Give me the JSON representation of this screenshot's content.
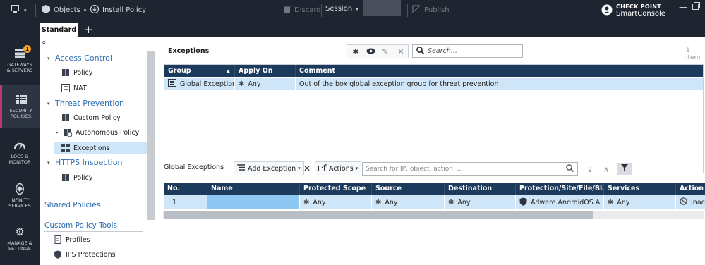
{
  "topbar": {
    "objects_label": "Objects",
    "install_policy_label": "Install Policy",
    "discard_label": "Discard",
    "session_label": "Session",
    "publish_label": "Publish",
    "brand_line1": "CHECK POINT",
    "brand_line2": "SmartConsole"
  },
  "tabs": {
    "active": "Standard",
    "add": "+"
  },
  "leftnav": {
    "badge": "1",
    "items": [
      {
        "label1": "GATEWAYS",
        "label2": "& SERVERS"
      },
      {
        "label1": "SECURITY",
        "label2": "POLICIES"
      },
      {
        "label1": "LOGS &",
        "label2": "MONITOR"
      },
      {
        "label1": "INFINITY",
        "label2": "SERVICES"
      },
      {
        "label1": "MANAGE &",
        "label2": "SETTINGS"
      }
    ]
  },
  "tree": {
    "collapse": "«",
    "access_control": "Access Control",
    "policy": "Policy",
    "nat": "NAT",
    "threat_prevention": "Threat Prevention",
    "custom_policy": "Custom Policy",
    "autonomous_policy": "Autonomous Policy",
    "exceptions": "Exceptions",
    "https_inspection": "HTTPS Inspection",
    "https_policy": "Policy",
    "shared_policies": "Shared Policies",
    "custom_policy_tools": "Custom Policy Tools",
    "profiles": "Profiles",
    "ips_protections": "IPS Protections"
  },
  "exceptions": {
    "title": "Exceptions",
    "search_placeholder": "Search...",
    "count": "1 item",
    "columns": [
      "Group",
      "Apply On",
      "Comment"
    ],
    "row": {
      "group": "Global Exceptions",
      "apply_on": "Any",
      "comment": "Out of the box global exception group for threat prevention"
    }
  },
  "global_exceptions": {
    "title": "Global Exceptions",
    "add_exception": "Add Exception",
    "actions": "Actions",
    "search_placeholder": "Search for IP, object, action, ...",
    "columns": [
      "No.",
      "Name",
      "Protected Scope",
      "Source",
      "Destination",
      "Protection/Site/File/Blade",
      "Services",
      "Action"
    ],
    "row": {
      "no": "1",
      "name": "",
      "protected_scope": "Any",
      "source": "Any",
      "destination": "Any",
      "protection": "Adware.AndroidOS.A...",
      "services": "Any",
      "action": "Inac"
    }
  },
  "colors": {
    "nav_bg": "#1e2530",
    "grid_header": "#1c3a5c",
    "selection": "#cfe6f9",
    "link_blue": "#2b6cb0",
    "accent": "#b8396b"
  }
}
